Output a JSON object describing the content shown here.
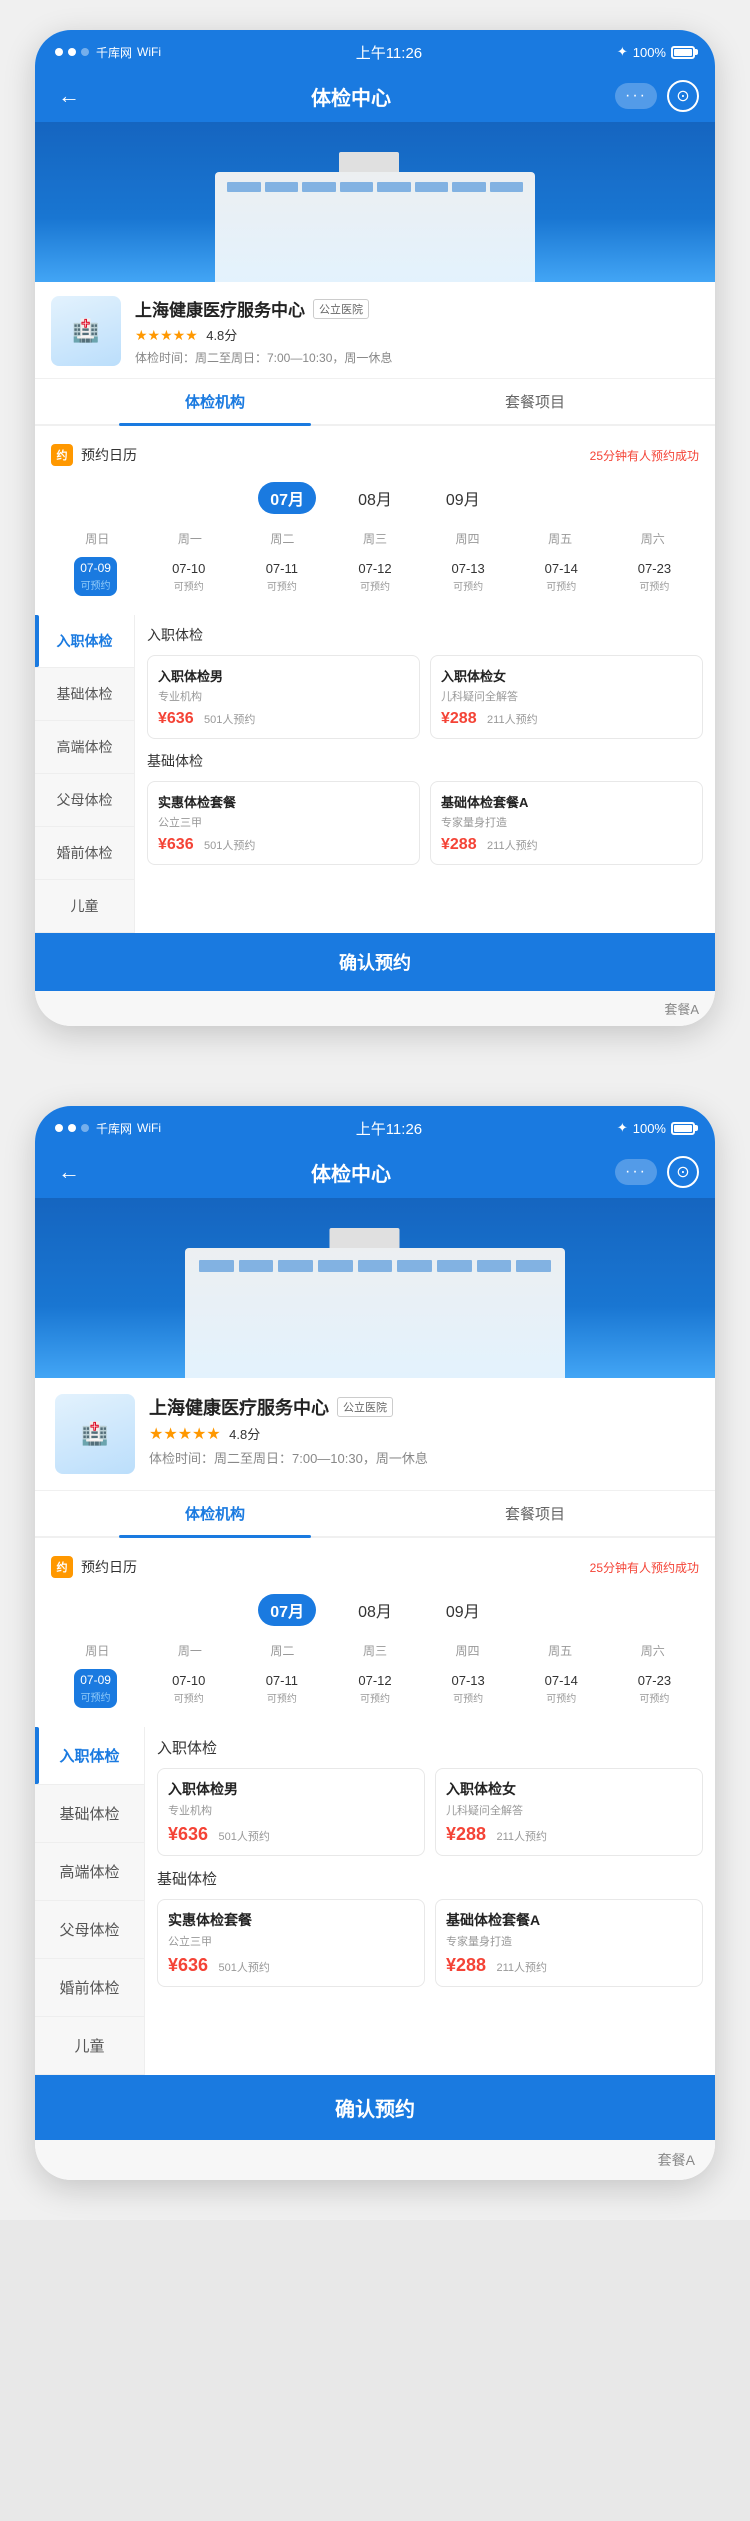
{
  "app": {
    "status_bar": {
      "carrier": "千库网",
      "time": "上午11:26",
      "signal": "100%"
    },
    "nav": {
      "title": "体检中心",
      "back_label": "←",
      "dots": "···",
      "camera_icon": "⊙"
    },
    "hospital": {
      "name": "上海健康医疗服务中心",
      "tag": "公立医院",
      "rating": "4.8分",
      "stars": "★★★★★",
      "hours": "体检时间：周二至周日：7:00—10:30，周一休息"
    },
    "tabs": {
      "tab1": "体检机构",
      "tab2": "套餐项目"
    },
    "calendar": {
      "badge": "约",
      "label": "预约日历",
      "notice": "25分钟有人预约成功",
      "months": [
        "07月",
        "08月",
        "09月"
      ],
      "active_month": "07月",
      "week_headers": [
        "周日",
        "周一",
        "周二",
        "周三",
        "周四",
        "周五",
        "周六"
      ],
      "days": [
        {
          "date": "07-09",
          "status": "可预约",
          "selected": true
        },
        {
          "date": "07-10",
          "status": "可预约",
          "selected": false
        },
        {
          "date": "07-11",
          "status": "可预约",
          "selected": false
        },
        {
          "date": "07-12",
          "status": "可预约",
          "selected": false
        },
        {
          "date": "07-13",
          "status": "可预约",
          "selected": false
        },
        {
          "date": "07-14",
          "status": "可预约",
          "selected": false
        },
        {
          "date": "07-23",
          "status": "可预约",
          "selected": false
        }
      ]
    },
    "categories": [
      {
        "label": "入职体检",
        "active": true
      },
      {
        "label": "基础体检",
        "active": false
      },
      {
        "label": "高端体检",
        "active": false
      },
      {
        "label": "父母体检",
        "active": false
      },
      {
        "label": "婚前体检",
        "active": false
      },
      {
        "label": "儿童",
        "active": false
      }
    ],
    "packages": {
      "section1": {
        "title": "入职体检",
        "cards": [
          {
            "name": "入职体检男",
            "desc": "专业机构",
            "price": "¥636",
            "count": "501人预约"
          },
          {
            "name": "入职体检女",
            "desc": "儿科疑问全解答",
            "price": "¥288",
            "count": "211人预约"
          }
        ]
      },
      "section2": {
        "title": "基础体检",
        "cards": [
          {
            "name": "实惠体检套餐",
            "desc": "公立三甲",
            "price": "¥636",
            "count": "501人预约"
          },
          {
            "name": "基础体检套餐A",
            "desc": "专家量身打造",
            "price": "¥288",
            "count": "211人预约"
          }
        ]
      }
    },
    "confirm_btn": "确认预约",
    "partial_label": "套餐A"
  }
}
